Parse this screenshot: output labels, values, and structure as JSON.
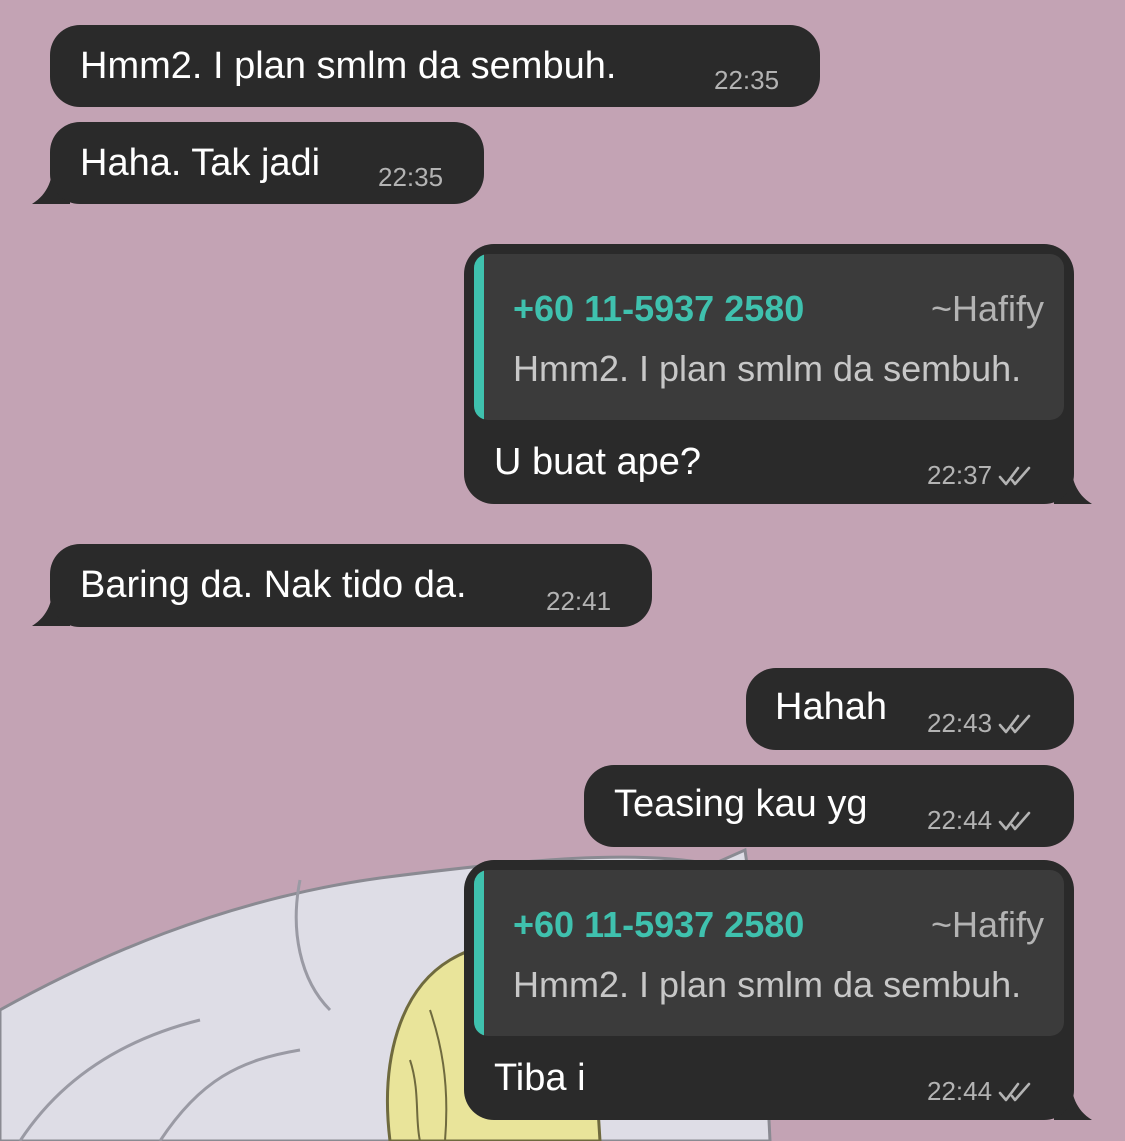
{
  "chat": {
    "messages": [
      {
        "direction": "incoming",
        "text": "Hmm2. I plan smlm da sembuh.",
        "time": "22:35"
      },
      {
        "direction": "incoming",
        "text": "Haha. Tak jadi",
        "time": "22:35"
      },
      {
        "direction": "outgoing",
        "reply_to": {
          "sender": "+60 11-5937 2580",
          "alias": "~Hafify",
          "text": "Hmm2. I plan smlm da sembuh."
        },
        "text": "U buat ape?",
        "time": "22:37",
        "status": "read"
      },
      {
        "direction": "incoming",
        "text": "Baring da. Nak tido da.",
        "time": "22:41"
      },
      {
        "direction": "outgoing",
        "text": "Hahah",
        "time": "22:43",
        "status": "read"
      },
      {
        "direction": "outgoing",
        "text": "Teasing kau yg",
        "time": "22:44",
        "status": "read"
      },
      {
        "direction": "outgoing",
        "reply_to": {
          "sender": "+60 11-5937 2580",
          "alias": "~Hafify",
          "text": "Hmm2. I plan smlm da sembuh."
        },
        "text": "Tiba i",
        "time": "22:44",
        "status": "read"
      }
    ]
  },
  "colors": {
    "background": "#c3a3b4",
    "bubble": "#2a2a2a",
    "quote_background": "#3b3b3b",
    "accent": "#3fc1ae",
    "timestamp": "#b3b3b3"
  },
  "icons": {
    "read_receipt": "double-check-icon"
  }
}
